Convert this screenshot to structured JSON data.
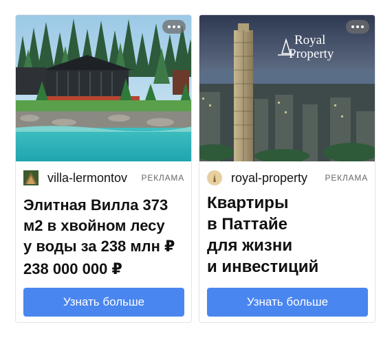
{
  "ads": [
    {
      "domain": "villa-lermontov",
      "label": "РЕКЛАМА",
      "title_lines": [
        "Элитная Вилла 373",
        "м2 в хвойном лесу",
        "у воды за 238 млн ₽"
      ],
      "price": "238 000 000 ₽",
      "button": "Узнать больше",
      "image_icon": "lakeside-villa-forest-photo",
      "favicon_icon": "villa-favicon"
    },
    {
      "domain": "royal-property",
      "label": "РЕКЛАМА",
      "title_lines": [
        "Квартиры",
        "в Паттайе",
        "для жизни",
        "и инвестиций"
      ],
      "button": "Узнать больше",
      "image_icon": "pattaya-skyscraper-photo",
      "logo_text": [
        "Royal",
        "Property"
      ],
      "favicon_icon": "royal-property-favicon"
    }
  ],
  "colors": {
    "button": "#4a86f0",
    "label": "#666666",
    "border": "#e4e4e4"
  }
}
